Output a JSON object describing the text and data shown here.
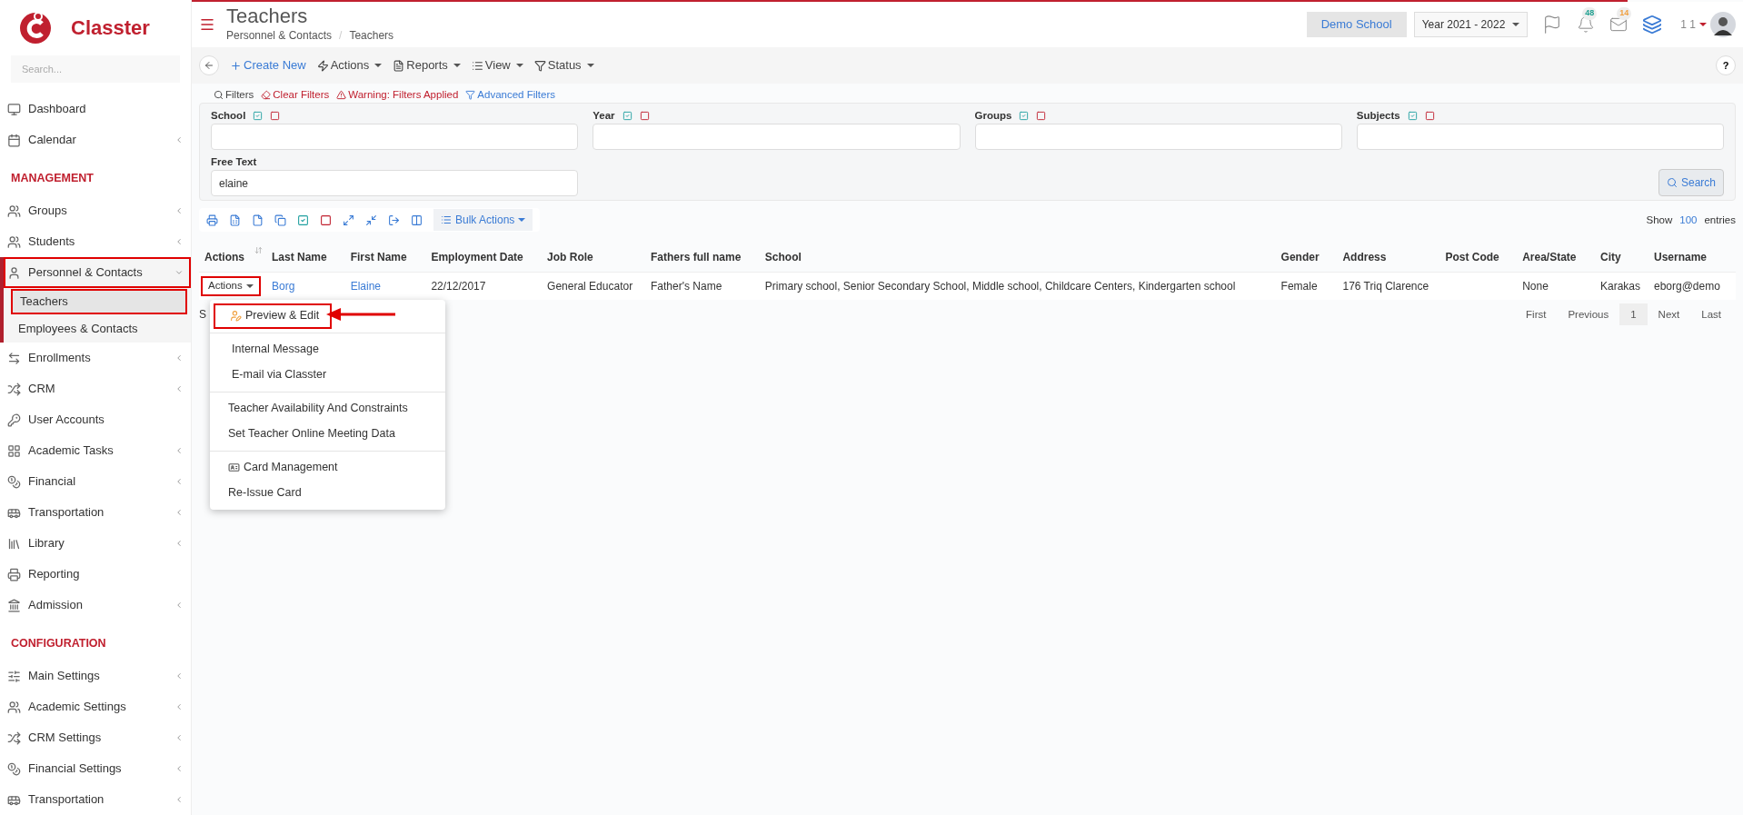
{
  "brand": {
    "name": "Classter"
  },
  "sidebar": {
    "search_placeholder": "Search...",
    "items": [
      {
        "kind": "item",
        "label": "Dashboard",
        "expanded": false,
        "has_children": false,
        "highlighted": false
      },
      {
        "kind": "item",
        "label": "Calendar",
        "expanded": false,
        "has_children": true,
        "highlighted": false
      },
      {
        "kind": "section",
        "label": "MANAGEMENT"
      },
      {
        "kind": "item",
        "label": "Groups",
        "expanded": false,
        "has_children": true,
        "highlighted": false
      },
      {
        "kind": "item",
        "label": "Students",
        "expanded": false,
        "has_children": true,
        "highlighted": false
      },
      {
        "kind": "item",
        "label": "Personnel & Contacts",
        "expanded": true,
        "has_children": true,
        "highlighted": true,
        "children": [
          {
            "label": "Teachers",
            "selected": true,
            "highlighted": true
          },
          {
            "label": "Employees & Contacts",
            "selected": false,
            "highlighted": false
          }
        ]
      },
      {
        "kind": "item",
        "label": "Enrollments",
        "expanded": false,
        "has_children": true,
        "highlighted": false
      },
      {
        "kind": "item",
        "label": "CRM",
        "expanded": false,
        "has_children": true,
        "highlighted": false
      },
      {
        "kind": "item",
        "label": "User Accounts",
        "expanded": false,
        "has_children": false,
        "highlighted": false
      },
      {
        "kind": "item",
        "label": "Academic Tasks",
        "expanded": false,
        "has_children": true,
        "highlighted": false
      },
      {
        "kind": "item",
        "label": "Financial",
        "expanded": false,
        "has_children": true,
        "highlighted": false
      },
      {
        "kind": "item",
        "label": "Transportation",
        "expanded": false,
        "has_children": true,
        "highlighted": false
      },
      {
        "kind": "item",
        "label": "Library",
        "expanded": false,
        "has_children": true,
        "highlighted": false
      },
      {
        "kind": "item",
        "label": "Reporting",
        "expanded": false,
        "has_children": false,
        "highlighted": false
      },
      {
        "kind": "item",
        "label": "Admission",
        "expanded": false,
        "has_children": true,
        "highlighted": false
      },
      {
        "kind": "section",
        "label": "CONFIGURATION"
      },
      {
        "kind": "item",
        "label": "Main Settings",
        "expanded": false,
        "has_children": true,
        "highlighted": false
      },
      {
        "kind": "item",
        "label": "Academic Settings",
        "expanded": false,
        "has_children": true,
        "highlighted": false
      },
      {
        "kind": "item",
        "label": "CRM Settings",
        "expanded": false,
        "has_children": true,
        "highlighted": false
      },
      {
        "kind": "item",
        "label": "Financial Settings",
        "expanded": false,
        "has_children": true,
        "highlighted": false
      },
      {
        "kind": "item",
        "label": "Transportation",
        "expanded": false,
        "has_children": true,
        "highlighted": false
      }
    ]
  },
  "header": {
    "title": "Teachers",
    "breadcrumb": [
      "Personnel & Contacts",
      "Teachers"
    ],
    "breadcrumb_separator": "/",
    "school": "Demo School",
    "year": "Year 2021 - 2022",
    "notifications": "48",
    "messages": "14",
    "user": "1 1"
  },
  "toolbar": {
    "items": [
      "Create New",
      "Actions",
      "Reports",
      "View",
      "Status"
    ],
    "help": "?"
  },
  "filters": {
    "links": [
      "Filters",
      "Clear Filters",
      "Warning: Filters Applied",
      "Advanced Filters"
    ],
    "fields": [
      {
        "label": "School",
        "toggles": true
      },
      {
        "label": "Year",
        "toggles": true
      },
      {
        "label": "Groups",
        "toggles": true
      },
      {
        "label": "Subjects",
        "toggles": true
      },
      {
        "label": "Free Text",
        "value": "elaine",
        "toggles": false
      }
    ],
    "search_button": "Search"
  },
  "table": {
    "bulk_actions": "Bulk Actions",
    "show_label": "Show",
    "page_length": "100",
    "entries_label": "entries",
    "columns": [
      "Actions",
      "Last Name",
      "First Name",
      "Employment Date",
      "Job Role",
      "Fathers full name",
      "School",
      "Gender",
      "Address",
      "Post Code",
      "Area/State",
      "City",
      "Username"
    ],
    "rows": [
      {
        "highlighted": true,
        "cells": [
          "Actions",
          "Borg",
          "Elaine",
          "22/12/2017",
          "General Educator",
          "Father's Name",
          "Primary school, Senior Secondary School, Middle school, Childcare Centers, Kindergarten school",
          "Female",
          "176 Triq Clarence",
          "",
          "None",
          "Karakas",
          "eborg@demo"
        ]
      }
    ],
    "info": "S",
    "pagination": [
      {
        "label": "First",
        "selected": false
      },
      {
        "label": "Previous",
        "selected": false
      },
      {
        "label": "1",
        "selected": true
      },
      {
        "label": "Next",
        "selected": false
      },
      {
        "label": "Last",
        "selected": false
      }
    ]
  },
  "action_menu": [
    {
      "kind": "edit",
      "label": "Preview & Edit",
      "highlighted": true
    },
    {
      "kind": "divider"
    },
    {
      "kind": "item",
      "label": "Internal Message"
    },
    {
      "kind": "item",
      "label": "E-mail via Classter"
    },
    {
      "kind": "divider"
    },
    {
      "kind": "item",
      "label": "Teacher Availability And Constraints"
    },
    {
      "kind": "item",
      "label": "Set Teacher Online Meeting Data"
    },
    {
      "kind": "divider"
    },
    {
      "kind": "card",
      "label": "Card Management"
    },
    {
      "kind": "item",
      "label": "Re-Issue Card"
    }
  ]
}
